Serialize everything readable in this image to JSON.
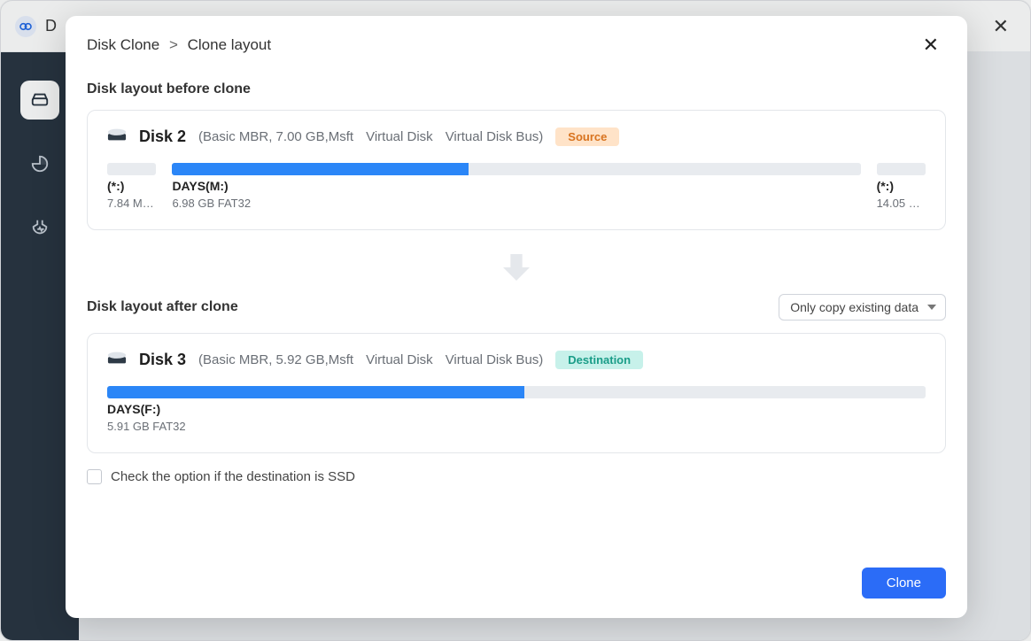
{
  "app": {
    "title_initial": "D",
    "close_glyph": "✕"
  },
  "sidebar": {
    "items": [
      {
        "name": "disk-icon"
      },
      {
        "name": "chart-icon"
      },
      {
        "name": "health-icon"
      }
    ]
  },
  "modal": {
    "breadcrumb": {
      "root": "Disk Clone",
      "leaf": "Clone layout",
      "sep": ">"
    },
    "close_glyph": "✕",
    "before_title": "Disk layout before clone",
    "after_title": "Disk layout after clone",
    "copy_mode": {
      "selected": "Only copy existing data"
    },
    "ssd_option": "Check the option if the destination is SSD",
    "clone_btn": "Clone"
  },
  "source_disk": {
    "name": "Disk 2",
    "spec": "(Basic MBR, 7.00 GB,Msft",
    "type": "Virtual Disk",
    "bus": "Virtual Disk Bus)",
    "badge": "Source",
    "partitions": [
      {
        "label": "(*:)",
        "sub": "7.84 MB...",
        "width_pct": 6,
        "fill_pct": 0
      },
      {
        "label": "DAYS(M:)",
        "sub": "6.98 GB FAT32",
        "width_pct": 83,
        "fill_pct": 43
      },
      {
        "label": "(*:)",
        "sub": "14.05 M...",
        "width_pct": 6,
        "fill_pct": 0
      }
    ]
  },
  "dest_disk": {
    "name": "Disk 3",
    "spec": "(Basic MBR, 5.92 GB,Msft",
    "type": "Virtual Disk",
    "bus": "Virtual Disk Bus)",
    "badge": "Destination",
    "partitions": [
      {
        "label": "DAYS(F:)",
        "sub": "5.91 GB FAT32",
        "width_pct": 100,
        "fill_pct": 51
      }
    ]
  }
}
